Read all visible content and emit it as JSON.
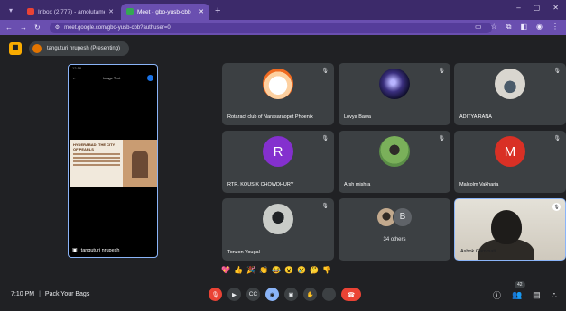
{
  "browser": {
    "tabs": [
      {
        "title": "Inbox (2,777) - amolutamenuti",
        "active": false,
        "favicon_color": "#ea4335"
      },
      {
        "title": "Meet - gbo-yusb-cbb",
        "active": true,
        "favicon_color": "#34a853"
      }
    ],
    "url": "meet.google.com/gbo-yusb-cbb?authuser=0",
    "icons": [
      "menu-icon",
      "back-icon",
      "forward-icon",
      "reload-icon",
      "tune-icon",
      "cast-icon",
      "star-icon",
      "extensions-icon",
      "sidepanel-icon",
      "profile-icon",
      "kebab-icon"
    ]
  },
  "presenter": {
    "label": "tanguturi nrupesh (Presenting)"
  },
  "shared_screen": {
    "status_left": "12:18",
    "header_left": "←",
    "header_mid": "Image     Text",
    "poster_heading": "HYDERABAD: THE CITY OF PEARLS",
    "presenter_name": "tanguturi nrupesh"
  },
  "participants": [
    {
      "name": "Rotaract club of Narasaraopet Phoenix",
      "avatar": "logo",
      "initial": ""
    },
    {
      "name": "Lovya Bawa",
      "avatar": "space",
      "initial": ""
    },
    {
      "name": "ADITYA RANA",
      "avatar": "cycle",
      "initial": ""
    },
    {
      "name": "RTR. KOUSIK CHOWDHURY",
      "avatar": "r",
      "initial": "R"
    },
    {
      "name": "Arsh mishra",
      "avatar": "arsh",
      "initial": ""
    },
    {
      "name": "Malcolm Vakharia",
      "avatar": "m",
      "initial": "M"
    },
    {
      "name": "Tonzon Yougal",
      "avatar": "tonzon",
      "initial": ""
    }
  ],
  "others_tile": {
    "initial": "B",
    "label": "34 others"
  },
  "camera_tile": {
    "name": "Ashok Gammati"
  },
  "reactions": [
    "💖",
    "👍",
    "🎉",
    "👏",
    "😂",
    "😮",
    "😢",
    "🤔",
    "👎"
  ],
  "meeting": {
    "time": "7:10 PM",
    "separator": "|",
    "title": "Pack Your Bags"
  },
  "people_count": "42",
  "colors": {
    "accent": "#8ab4f8",
    "danger": "#ea4335",
    "surface": "#202124",
    "tile": "#3c4043",
    "browser_purple": "#6a4fb0"
  }
}
